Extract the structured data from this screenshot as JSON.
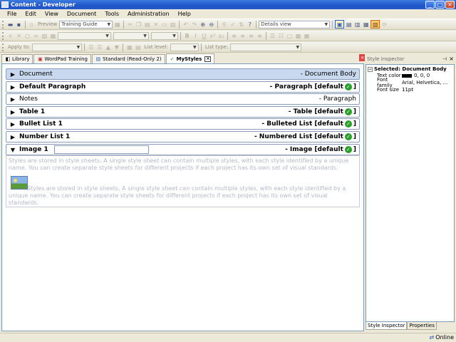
{
  "window": {
    "title": "Content - Developer"
  },
  "menu": [
    "File",
    "Edit",
    "View",
    "Document",
    "Tools",
    "Administration",
    "Help"
  ],
  "toolbar": {
    "preview_label": "Preview",
    "template_combo": "Training Guide",
    "view_combo": "Details view",
    "apply_to_label": "Apply to:",
    "list_level_label": "List level:",
    "list_type_label": "List type:"
  },
  "doc_tabs": [
    {
      "label": "Library"
    },
    {
      "label": "WordPad Training"
    },
    {
      "label": "Standard (Read-Only 2)"
    },
    {
      "label": "MyStyles"
    }
  ],
  "styles": [
    {
      "name": "Document",
      "type": "- Document Body",
      "default_suffix": ""
    },
    {
      "name": "Default Paragraph",
      "type": "- Paragraph",
      "default_suffix": "[default",
      "close": "]"
    },
    {
      "name": "Notes",
      "type": "- Paragraph",
      "default_suffix": ""
    },
    {
      "name": "Table 1",
      "type": "- Table",
      "default_suffix": "[default",
      "close": "]"
    },
    {
      "name": "Bullet List 1",
      "type": "- Bulleted List",
      "default_suffix": "[default",
      "close": "]"
    },
    {
      "name": "Number List 1",
      "type": "- Numbered List",
      "default_suffix": "[default",
      "close": "]"
    },
    {
      "name": "Image 1",
      "type": "- Image",
      "default_suffix": "[default",
      "close": "]"
    }
  ],
  "preview": {
    "text1": "Styles are stored in style sheets. A single style sheet can contain multiple styles, with each style identified by a unique name. You can create separate style sheets for different projects if each project has its own set of visual standards.",
    "text2": "Styles are stored in style sheets. A single style sheet can contain multiple styles, with each style identified by a unique name. You can create separate style sheets for different projects if each project has its own set of visual standards."
  },
  "inspector": {
    "header": "Style Inspector",
    "selected": "Selected: Document Body",
    "rows": [
      {
        "key": "Text color",
        "value": "0, 0, 0"
      },
      {
        "key": "Font family",
        "value": "Arial, Helvetica, ..."
      },
      {
        "key": "Font size",
        "value": "11pt"
      }
    ],
    "tabs": [
      "Style Inspector",
      "Properties"
    ]
  },
  "status": {
    "text": "Online"
  }
}
